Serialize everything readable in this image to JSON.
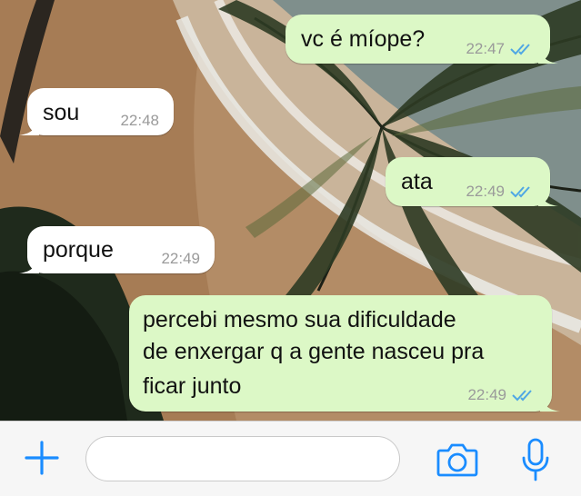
{
  "messages": [
    {
      "direction": "out",
      "text": "vc é míope?",
      "time": "22:47",
      "read": true
    },
    {
      "direction": "in",
      "text": "sou",
      "time": "22:48"
    },
    {
      "direction": "out",
      "text": "ata",
      "time": "22:49",
      "read": true
    },
    {
      "direction": "in",
      "text": "porque",
      "time": "22:49"
    },
    {
      "direction": "out",
      "lines": [
        "percebi mesmo sua dificuldade",
        "de enxergar q a gente nasceu pra",
        "ficar junto"
      ],
      "time": "22:49",
      "read": true
    }
  ],
  "input": {
    "placeholder": "",
    "value": ""
  },
  "icons": {
    "add": "plus-icon",
    "camera": "camera-icon",
    "mic": "microphone-icon",
    "read_receipt": "double-check-icon"
  },
  "colors": {
    "outgoing_bubble": "#dcf8c6",
    "incoming_bubble": "#ffffff",
    "accent": "#1a8cff",
    "read_ticks": "#4fa7e4"
  }
}
